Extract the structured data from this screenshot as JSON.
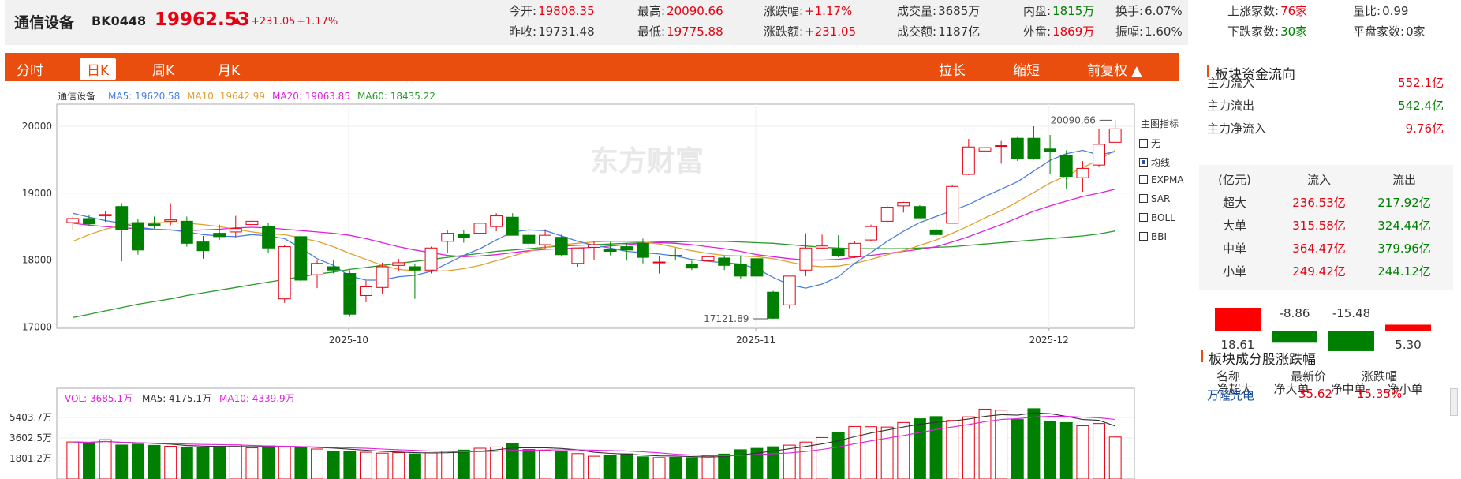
{
  "header": {
    "name": "通信设备",
    "code": "BK0448",
    "price": "19962.53",
    "change": "+231.05",
    "change_pct": "+1.17%",
    "stats": [
      {
        "label": "今开:",
        "value": "19808.35",
        "tone": "red"
      },
      {
        "label": "最高:",
        "value": "20090.66",
        "tone": "red"
      },
      {
        "label": "涨跌幅:",
        "value": "+1.17%",
        "tone": "red"
      },
      {
        "label": "成交量:",
        "value": "3685万",
        "tone": "dark"
      },
      {
        "label": "内盘:",
        "value": "1815万",
        "tone": "green"
      },
      {
        "label": "换手:",
        "value": "6.07%",
        "tone": "dark"
      },
      {
        "label": "上涨家数:",
        "value": "76家",
        "tone": "red"
      },
      {
        "label": "量比:",
        "value": "0.99",
        "tone": "dark"
      },
      {
        "label": "昨收:",
        "value": "19731.48",
        "tone": "dark"
      },
      {
        "label": "最低:",
        "value": "19775.88",
        "tone": "red"
      },
      {
        "label": "涨跌额:",
        "value": "+231.05",
        "tone": "red"
      },
      {
        "label": "成交额:",
        "value": "1187亿",
        "tone": "dark"
      },
      {
        "label": "外盘:",
        "value": "1869万",
        "tone": "red"
      },
      {
        "label": "振幅:",
        "value": "1.60%",
        "tone": "dark"
      },
      {
        "label": "下跌家数:",
        "value": "30家",
        "tone": "green"
      },
      {
        "label": "平盘家数:",
        "value": "0家",
        "tone": "dark"
      }
    ]
  },
  "toolbar": {
    "left_tabs": [
      "分时",
      "日K",
      "周K",
      "月K"
    ],
    "active_tab": "日K",
    "stretch": "拉长",
    "shrink": "缩短",
    "adjust": "前复权 ▲"
  },
  "kline": {
    "legend_name": "通信设备",
    "ma5": "MA5: 19620.58",
    "ma10": "MA10: 19642.99",
    "ma20": "MA20: 19063.85",
    "ma60": "MA60: 18435.22",
    "watermark": "东方财富",
    "max_label": "20090.66",
    "min_label": "17121.89",
    "y_ticks": [
      "20000",
      "19000",
      "18000",
      "17000"
    ],
    "x_ticks": [
      "2025-10",
      "2025-11",
      "2025-12"
    ],
    "indicators_title": "主图指标",
    "indicators": [
      {
        "label": "无",
        "checked": false
      },
      {
        "label": "均线",
        "checked": true
      },
      {
        "label": "EXPMA",
        "checked": false
      },
      {
        "label": "SAR",
        "checked": false
      },
      {
        "label": "BOLL",
        "checked": false
      },
      {
        "label": "BBI",
        "checked": false
      }
    ],
    "colors": {
      "up": "#e60012",
      "down": "#008000",
      "ma5": "#4a7fe0",
      "ma10": "#e0a030",
      "ma20": "#e020e0",
      "ma60": "#2a9a2a"
    }
  },
  "volume": {
    "vol": "VOL: 3685.1万",
    "ma5": "MA5: 4175.1万",
    "ma10": "MA10: 4339.9万",
    "y_ticks": [
      "5403.7万",
      "3602.5万",
      "1801.2万"
    ]
  },
  "chart_data": {
    "type": "candlestick",
    "x_ticks": [
      "2025-10",
      "2025-11",
      "2025-12"
    ],
    "ylim": [
      17000,
      20300
    ],
    "candles": [
      [
        18560,
        18650,
        18450,
        18620
      ],
      [
        18620,
        18680,
        18520,
        18540
      ],
      [
        18660,
        18730,
        18570,
        18680
      ],
      [
        18800,
        18850,
        17980,
        18450
      ],
      [
        18560,
        18620,
        18080,
        18150
      ],
      [
        18540,
        18650,
        18470,
        18520
      ],
      [
        18580,
        18850,
        18520,
        18600
      ],
      [
        18580,
        18650,
        18200,
        18250
      ],
      [
        18270,
        18360,
        18020,
        18140
      ],
      [
        18400,
        18530,
        18300,
        18350
      ],
      [
        18420,
        18660,
        18340,
        18470
      ],
      [
        18530,
        18620,
        18520,
        18580
      ],
      [
        18500,
        18550,
        18100,
        18180
      ],
      [
        17420,
        18230,
        17360,
        18200
      ],
      [
        18350,
        18390,
        17650,
        17700
      ],
      [
        17780,
        18000,
        17580,
        17950
      ],
      [
        17900,
        18000,
        17800,
        17850
      ],
      [
        17800,
        17850,
        17150,
        17190
      ],
      [
        17470,
        17690,
        17370,
        17600
      ],
      [
        17590,
        17960,
        17500,
        17900
      ],
      [
        17920,
        18020,
        17830,
        17960
      ],
      [
        17900,
        17950,
        17420,
        17850
      ],
      [
        17850,
        18200,
        17800,
        18180
      ],
      [
        18280,
        18450,
        18100,
        18400
      ],
      [
        18390,
        18450,
        18260,
        18340
      ],
      [
        18400,
        18620,
        18330,
        18550
      ],
      [
        18500,
        18700,
        18430,
        18660
      ],
      [
        18640,
        18700,
        18380,
        18370
      ],
      [
        18370,
        18430,
        18170,
        18250
      ],
      [
        18230,
        18460,
        18170,
        18370
      ],
      [
        18340,
        18380,
        18050,
        18080
      ],
      [
        17950,
        18150,
        17900,
        18180
      ],
      [
        18190,
        18280,
        18000,
        18230
      ],
      [
        18160,
        18270,
        18070,
        18130
      ],
      [
        18200,
        18250,
        17990,
        18150
      ],
      [
        18250,
        18320,
        17950,
        18040
      ],
      [
        17960,
        18060,
        17800,
        17970
      ],
      [
        18070,
        18180,
        18000,
        18060
      ],
      [
        17930,
        17990,
        17850,
        17880
      ],
      [
        17990,
        18130,
        17960,
        18050
      ],
      [
        18030,
        18070,
        17850,
        17920
      ],
      [
        17940,
        18070,
        17710,
        17760
      ],
      [
        18020,
        18090,
        17660,
        17760
      ],
      [
        17520,
        17540,
        17120,
        17130
      ],
      [
        17330,
        17750,
        17280,
        17760
      ],
      [
        17850,
        18400,
        17760,
        18180
      ],
      [
        18180,
        18380,
        18160,
        18210
      ],
      [
        18170,
        18370,
        18040,
        18060
      ],
      [
        18050,
        18280,
        18030,
        18250
      ],
      [
        18300,
        18530,
        18290,
        18500
      ],
      [
        18580,
        18820,
        18560,
        18790
      ],
      [
        18810,
        18870,
        18710,
        18860
      ],
      [
        18800,
        18820,
        18640,
        18630
      ],
      [
        18450,
        18570,
        18320,
        18380
      ],
      [
        18550,
        19120,
        18550,
        19100
      ],
      [
        19280,
        19810,
        19270,
        19690
      ],
      [
        19630,
        19800,
        19440,
        19680
      ],
      [
        19710,
        19780,
        19440,
        19710
      ],
      [
        19820,
        19850,
        19480,
        19510
      ],
      [
        19820,
        20000,
        19500,
        19510
      ],
      [
        19660,
        19870,
        19280,
        19620
      ],
      [
        19570,
        19640,
        19070,
        19250
      ],
      [
        19230,
        19480,
        19020,
        19370
      ],
      [
        19420,
        19960,
        19400,
        19730
      ],
      [
        19760,
        20090,
        19760,
        19960
      ]
    ],
    "ma5": [
      18700,
      18640,
      18590,
      18550,
      18490,
      18460,
      18450,
      18420,
      18380,
      18360,
      18350,
      18380,
      18360,
      18320,
      18180,
      18020,
      17920,
      17760,
      17700,
      17700,
      17750,
      17770,
      17830,
      17950,
      18070,
      18170,
      18300,
      18420,
      18450,
      18440,
      18360,
      18280,
      18220,
      18180,
      18130,
      18110,
      18090,
      18060,
      18010,
      17980,
      17960,
      17940,
      17870,
      17740,
      17630,
      17580,
      17640,
      17750,
      17950,
      18110,
      18280,
      18430,
      18560,
      18650,
      18740,
      18830,
      18950,
      19060,
      19170,
      19330,
      19490,
      19590,
      19640,
      19570,
      19620
    ],
    "ma10": [
      18280,
      18380,
      18460,
      18520,
      18550,
      18560,
      18560,
      18550,
      18530,
      18500,
      18460,
      18420,
      18390,
      18380,
      18330,
      18280,
      18200,
      18100,
      18010,
      17920,
      17860,
      17840,
      17830,
      17840,
      17870,
      17920,
      17990,
      18060,
      18130,
      18190,
      18230,
      18250,
      18270,
      18280,
      18280,
      18270,
      18240,
      18190,
      18140,
      18100,
      18070,
      18060,
      18050,
      18020,
      17970,
      17920,
      17900,
      17910,
      17950,
      18010,
      18080,
      18140,
      18220,
      18300,
      18400,
      18510,
      18630,
      18740,
      18870,
      19010,
      19150,
      19260,
      19380,
      19500,
      19640
    ],
    "ma20": [
      18550,
      18520,
      18500,
      18480,
      18470,
      18460,
      18450,
      18440,
      18450,
      18460,
      18480,
      18490,
      18480,
      18460,
      18440,
      18420,
      18400,
      18370,
      18320,
      18260,
      18200,
      18150,
      18110,
      18070,
      18050,
      18060,
      18080,
      18110,
      18140,
      18160,
      18170,
      18180,
      18190,
      18210,
      18230,
      18250,
      18260,
      18250,
      18230,
      18200,
      18170,
      18130,
      18080,
      18050,
      18020,
      18000,
      18000,
      18010,
      18040,
      18070,
      18100,
      18130,
      18160,
      18200,
      18270,
      18350,
      18440,
      18530,
      18630,
      18730,
      18810,
      18880,
      18950,
      19000,
      19060
    ],
    "ma60": [
      17140,
      17190,
      17240,
      17290,
      17340,
      17380,
      17420,
      17470,
      17510,
      17550,
      17590,
      17630,
      17670,
      17710,
      17750,
      17790,
      17820,
      17860,
      17890,
      17920,
      17950,
      17980,
      18010,
      18040,
      18070,
      18100,
      18130,
      18150,
      18170,
      18190,
      18210,
      18220,
      18230,
      18240,
      18250,
      18260,
      18270,
      18270,
      18280,
      18280,
      18280,
      18270,
      18260,
      18250,
      18230,
      18210,
      18190,
      18180,
      18170,
      18170,
      18170,
      18170,
      18180,
      18190,
      18200,
      18220,
      18240,
      18260,
      18280,
      18300,
      18320,
      18340,
      18360,
      18390,
      18435
    ],
    "volume": [
      3250,
      3180,
      3450,
      2980,
      3060,
      2950,
      2870,
      2810,
      2760,
      2870,
      2990,
      2730,
      2900,
      2820,
      2750,
      2630,
      2460,
      2440,
      2350,
      2270,
      2310,
      2200,
      2300,
      2450,
      2540,
      2700,
      2810,
      3100,
      2590,
      2510,
      2400,
      2230,
      2000,
      2110,
      2210,
      1950,
      1880,
      1910,
      1880,
      2020,
      2190,
      2570,
      2690,
      2830,
      2970,
      3240,
      3640,
      4090,
      4610,
      4590,
      4560,
      4960,
      5290,
      5480,
      5140,
      5460,
      6130,
      6040,
      5220,
      6170,
      5090,
      4950,
      4670,
      4870,
      3685
    ]
  },
  "right_panel": {
    "flow_title": "板块资金流向",
    "main_rows": [
      {
        "label": "主力流入",
        "value": "552.1亿"
      },
      {
        "label": "主力流出",
        "value": "542.4亿"
      },
      {
        "label": "主力净流入",
        "value": "9.76亿"
      }
    ],
    "table_headers": [
      "(亿元)",
      "流入",
      "流出"
    ],
    "table_rows": [
      {
        "label": "超大",
        "in": "236.53亿",
        "out": "217.92亿"
      },
      {
        "label": "大单",
        "in": "315.58亿",
        "out": "324.44亿"
      },
      {
        "label": "中单",
        "in": "364.47亿",
        "out": "379.96亿"
      },
      {
        "label": "小单",
        "in": "249.42亿",
        "out": "244.12亿"
      }
    ],
    "net_bars": [
      {
        "label": "净超大",
        "value": "18.61",
        "num": 18.61
      },
      {
        "label": "净大单",
        "value": "-8.86",
        "num": -8.86
      },
      {
        "label": "净中单",
        "value": "-15.48",
        "num": -15.48
      },
      {
        "label": "净小单",
        "value": "5.30",
        "num": 5.3
      }
    ],
    "stocks_title": "板块成分股涨跌幅",
    "stocks_headers": [
      "名称",
      "最新价",
      "涨跌幅"
    ],
    "stocks": [
      {
        "name": "万隆光电",
        "price": "35.62",
        "pct": "15.35%"
      }
    ]
  }
}
